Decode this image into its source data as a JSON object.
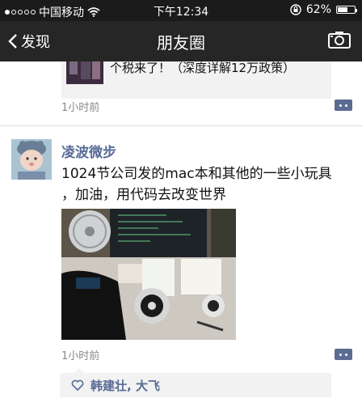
{
  "status_bar": {
    "carrier": "中国移动",
    "time": "下午12:34",
    "battery": "62%",
    "battery_level": 0.62
  },
  "nav": {
    "back_label": "发现",
    "title": "朋友圈"
  },
  "prev_post": {
    "share_line1": "个税来了！（深度详解12万政策）",
    "time": "1小时前"
  },
  "post": {
    "author": "凌波微步",
    "text_line1": "1024节公司发的mac本和其他的一些小玩具",
    "text_line2": "，加油，用代码去改变世界",
    "time": "1小时前",
    "likes": {
      "name1": "韩建壮",
      "separator": ", ",
      "name2": "大飞"
    }
  },
  "colors": {
    "link": "#576b95",
    "navbar": "#262626",
    "statusbar": "#1b1b1b"
  },
  "icons": [
    "signal-dots-icon",
    "wifi-icon",
    "rotation-lock-icon",
    "battery-icon",
    "back-chevron-icon",
    "camera-icon",
    "comment-icon",
    "heart-icon"
  ]
}
